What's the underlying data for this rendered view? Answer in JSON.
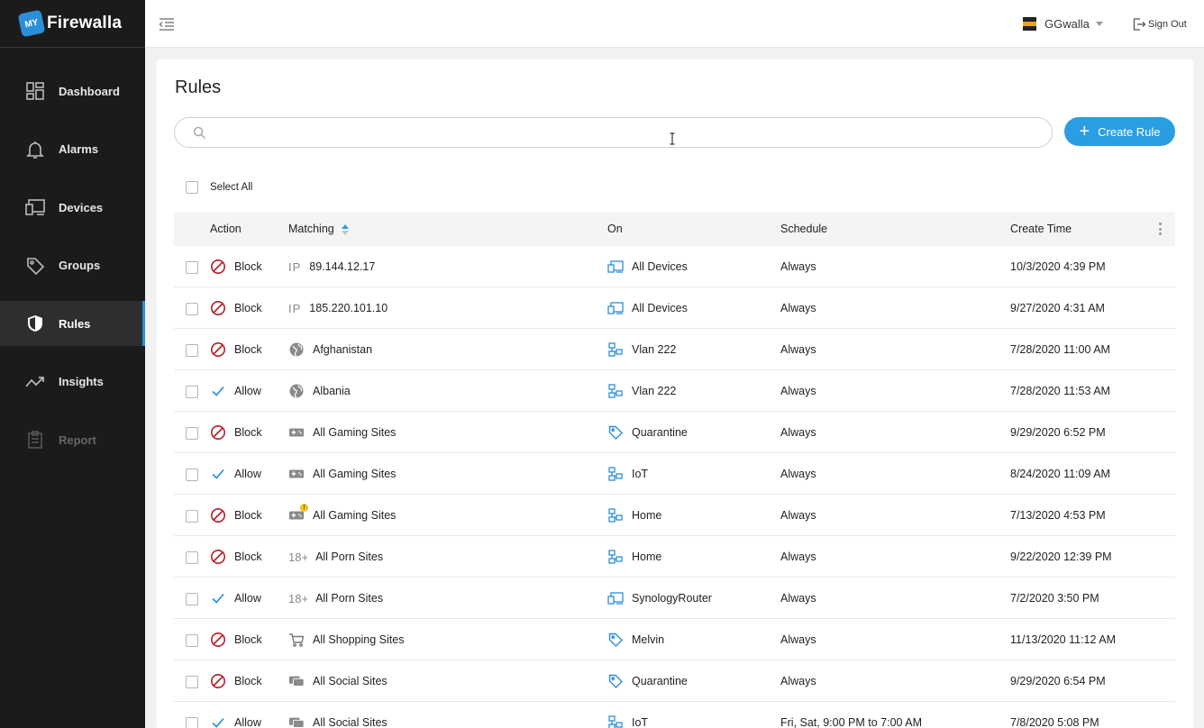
{
  "app": {
    "logo_badge": "MY",
    "logo_text": "Firewalla"
  },
  "sidebar": {
    "items": [
      {
        "label": "Dashboard",
        "icon": "dashboard-icon",
        "active": false,
        "disabled": false
      },
      {
        "label": "Alarms",
        "icon": "bell-icon",
        "active": false,
        "disabled": false
      },
      {
        "label": "Devices",
        "icon": "devices-icon",
        "active": false,
        "disabled": false
      },
      {
        "label": "Groups",
        "icon": "tag-icon",
        "active": false,
        "disabled": false
      },
      {
        "label": "Rules",
        "icon": "shield-icon",
        "active": true,
        "disabled": false
      },
      {
        "label": "Insights",
        "icon": "trend-icon",
        "active": false,
        "disabled": false
      },
      {
        "label": "Report",
        "icon": "clipboard-icon",
        "active": false,
        "disabled": true
      }
    ]
  },
  "header": {
    "user_name": "GGwalla",
    "signout_label": "Sign Out"
  },
  "main": {
    "title": "Rules",
    "search": {
      "value": "",
      "placeholder": ""
    },
    "create_label": "Create Rule",
    "select_all_label": "Select All",
    "columns": {
      "action": "Action",
      "matching": "Matching",
      "on": "On",
      "schedule": "Schedule",
      "create_time": "Create Time"
    },
    "rows": [
      {
        "action": "Block",
        "match_type": "ip",
        "match": "89.144.12.17",
        "on_type": "devices",
        "on": "All Devices",
        "schedule": "Always",
        "time": "10/3/2020 4:39 PM"
      },
      {
        "action": "Block",
        "match_type": "ip",
        "match": "185.220.101.10",
        "on_type": "devices",
        "on": "All Devices",
        "schedule": "Always",
        "time": "9/27/2020 4:31 AM"
      },
      {
        "action": "Block",
        "match_type": "globe",
        "match": "Afghanistan",
        "on_type": "network",
        "on": "Vlan 222",
        "schedule": "Always",
        "time": "7/28/2020 11:00 AM"
      },
      {
        "action": "Allow",
        "match_type": "globe",
        "match": "Albania",
        "on_type": "network",
        "on": "Vlan 222",
        "schedule": "Always",
        "time": "7/28/2020 11:53 AM"
      },
      {
        "action": "Block",
        "match_type": "gamepad",
        "match": "All Gaming Sites",
        "on_type": "tag",
        "on": "Quarantine",
        "schedule": "Always",
        "time": "9/29/2020 6:52 PM"
      },
      {
        "action": "Allow",
        "match_type": "gamepad",
        "match": "All Gaming Sites",
        "on_type": "network",
        "on": "IoT",
        "schedule": "Always",
        "time": "8/24/2020 11:09 AM"
      },
      {
        "action": "Block",
        "match_type": "gamepad-warn",
        "match": "All Gaming Sites",
        "on_type": "network",
        "on": "Home",
        "schedule": "Always",
        "time": "7/13/2020 4:53 PM"
      },
      {
        "action": "Block",
        "match_type": "age",
        "match": "All Porn Sites",
        "on_type": "network",
        "on": "Home",
        "schedule": "Always",
        "time": "9/22/2020 12:39 PM"
      },
      {
        "action": "Allow",
        "match_type": "age",
        "match": "All Porn Sites",
        "on_type": "devices",
        "on": "SynologyRouter",
        "schedule": "Always",
        "time": "7/2/2020 3:50 PM"
      },
      {
        "action": "Block",
        "match_type": "cart",
        "match": "All Shopping Sites",
        "on_type": "tag",
        "on": "Melvin",
        "schedule": "Always",
        "time": "11/13/2020 11:12 AM"
      },
      {
        "action": "Block",
        "match_type": "chat",
        "match": "All Social Sites",
        "on_type": "tag",
        "on": "Quarantine",
        "schedule": "Always",
        "time": "9/29/2020 6:54 PM"
      },
      {
        "action": "Allow",
        "match_type": "chat",
        "match": "All Social Sites",
        "on_type": "network",
        "on": "IoT",
        "schedule": "Fri, Sat, 9:00 PM to 7:00 AM",
        "time": "7/8/2020 5:08 PM"
      }
    ],
    "icon_text": {
      "ip": "IP",
      "age": "18+",
      "warn": "!"
    }
  },
  "colors": {
    "accent": "#2b9ee3",
    "block": "#b0202a",
    "allow": "#2b8fd8",
    "sidebar_bg": "#1b1b1b"
  }
}
